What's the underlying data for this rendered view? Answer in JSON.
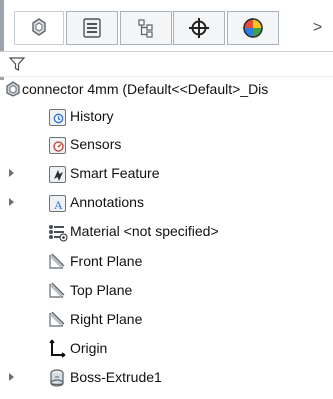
{
  "window": {
    "tabs": [
      {
        "name": "feature-manager-tab",
        "icon": "featuremanager-tree-icon",
        "active": true
      },
      {
        "name": "property-manager-tab",
        "icon": "property-sheet-icon",
        "active": false
      },
      {
        "name": "configuration-manager-tab",
        "icon": "configuration-tree-icon",
        "active": false
      },
      {
        "name": "dimxpert-tab",
        "icon": "crosshair-icon",
        "active": false
      },
      {
        "name": "display-manager-tab",
        "icon": "appearance-ball-icon",
        "active": false
      }
    ],
    "overflow_label": ">",
    "filter_icon": "filter-icon"
  },
  "tree": {
    "root_label": "connector 4mm  (Default<<Default>_Dis",
    "items": [
      {
        "label": "History",
        "icon": "history-icon",
        "expandable": false
      },
      {
        "label": "Sensors",
        "icon": "sensors-icon",
        "expandable": false
      },
      {
        "label": "Smart Feature",
        "icon": "smart-feature-icon",
        "expandable": true
      },
      {
        "label": "Annotations",
        "icon": "annotations-icon",
        "expandable": true
      },
      {
        "label": "Material <not specified>",
        "icon": "material-icon",
        "expandable": false
      },
      {
        "label": "Front Plane",
        "icon": "plane-icon",
        "expandable": false
      },
      {
        "label": "Top Plane",
        "icon": "plane-icon",
        "expandable": false
      },
      {
        "label": "Right Plane",
        "icon": "plane-icon",
        "expandable": false
      },
      {
        "label": "Origin",
        "icon": "origin-icon",
        "expandable": false
      },
      {
        "label": "Boss-Extrude1",
        "icon": "boss-extrude-icon",
        "expandable": true
      }
    ]
  },
  "colors": {
    "accent_blue": "#2f6fdb",
    "accent_orange": "#f0a000",
    "text": "#111111"
  }
}
